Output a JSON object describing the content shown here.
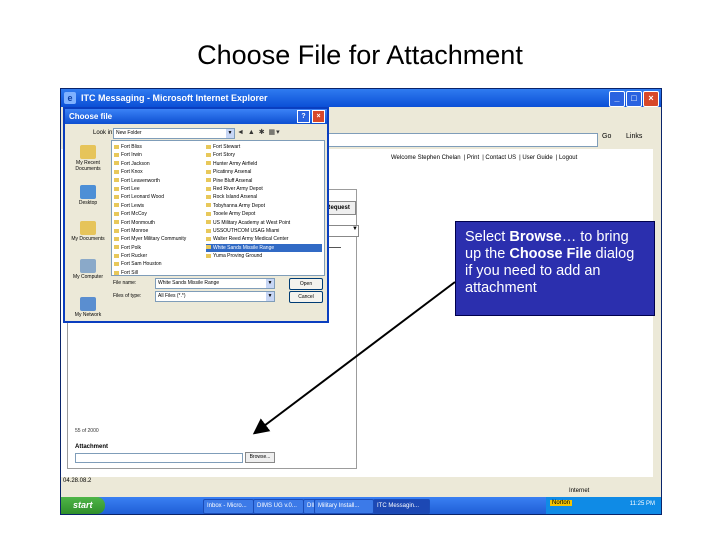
{
  "slide": {
    "title": "Choose File for Attachment"
  },
  "browser": {
    "title": "ITC Messaging - Microsoft Internet Explorer",
    "go_label": "Go",
    "links_label": "Links",
    "nav": {
      "welcome": "Welcome Stephen Chelan",
      "print": "Print",
      "contact": "Contact US",
      "guide": "User Guide",
      "logout": "Logout"
    },
    "request_label": "Request",
    "counter": "55 of 2000",
    "attachment_label": "Attachment",
    "browse_label": "Browse...",
    "version": "04.28.08.2",
    "status_zone": "Internet"
  },
  "dialog": {
    "title": "Choose file",
    "lookin_label": "Look in:",
    "lookin_value": "New Folder",
    "places": [
      "My Recent Documents",
      "Desktop",
      "My Documents",
      "My Computer",
      "My Network"
    ],
    "files_col1": [
      "Fort Bliss",
      "Fort Irwin",
      "Fort Jackson",
      "Fort Knox",
      "Fort Leavenworth",
      "Fort Lee",
      "Fort Leonard Wood",
      "Fort Lewis",
      "Fort McCoy",
      "Fort Monmouth",
      "Fort Monroe",
      "Fort Myer Military Community",
      "Fort Polk",
      "Fort Rucker",
      "Fort Sam Houston",
      "Fort Sill"
    ],
    "files_col2": [
      "Fort Stewart",
      "Fort Story",
      "Hunter Army Airfield",
      "Picatinny Arsenal",
      "Pine Bluff Arsenal",
      "Red River Army Depot",
      "Rock Island Arsenal",
      "Tobyhanna Army Depot",
      "Tooele Army Depot",
      "US Military Academy at West Point",
      "USSOUTHCOM USAG Miami",
      "Walter Reed Army Medical Center",
      "White Sands Missile Range",
      "Yuma Proving Ground"
    ],
    "selected": "White Sands Missile Range",
    "filename_label": "File name:",
    "filename_value": "White Sands Missile Range",
    "filetype_label": "Files of type:",
    "filetype_value": "All Files (*.*)",
    "open_label": "Open",
    "cancel_label": "Cancel"
  },
  "taskbar": {
    "start": "start",
    "tasks": [
      "Inbox - Micro...",
      "DIMS UG v.0...",
      "DIMS User...",
      "Military Install...",
      "ITC Messagin..."
    ],
    "nrt": "Norton",
    "clock": "11:25 PM"
  },
  "callout": {
    "p1": "Select ",
    "b1": "Browse",
    "p2": "… to bring up the ",
    "b2": "Choose File",
    "p3": " dialog if you need to add an attachment"
  },
  "colors": {
    "callout_bg": "#2b2fae",
    "xp_blue": "#0b4fd6",
    "selection": "#316ac5"
  }
}
